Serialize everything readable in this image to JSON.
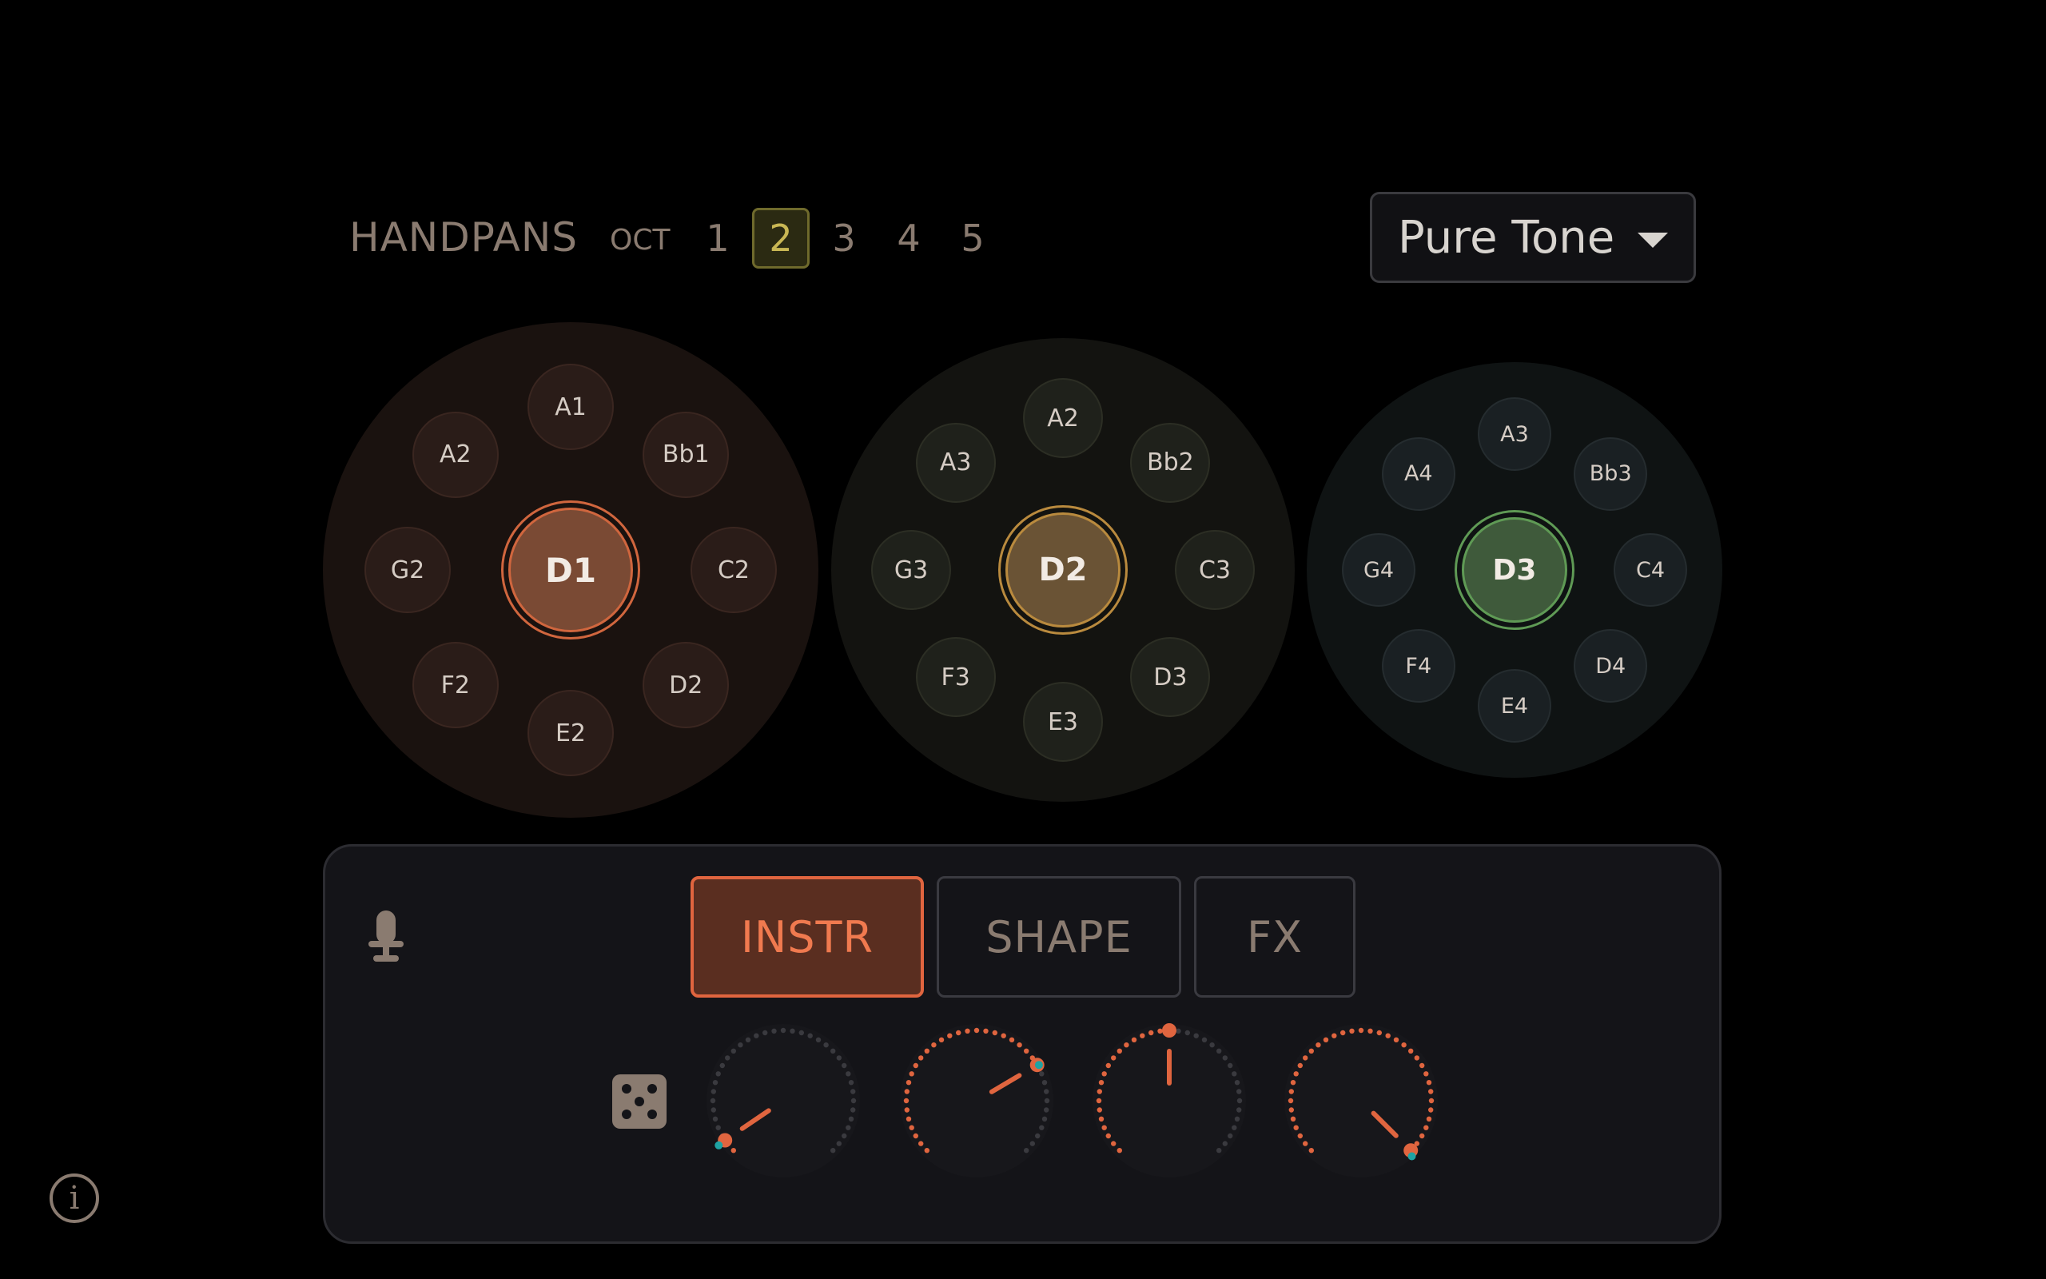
{
  "header": {
    "title": "HANDPANS",
    "oct_label": "OCT",
    "octaves": [
      "1",
      "2",
      "3",
      "4",
      "5"
    ],
    "active_octave": "2"
  },
  "sound_select": {
    "value": "Pure Tone"
  },
  "pans": [
    {
      "center": "D1",
      "notes": [
        "A1",
        "Bb1",
        "C2",
        "D2",
        "E2",
        "F2",
        "G2",
        "A2"
      ],
      "accent": "#d0663e"
    },
    {
      "center": "D2",
      "notes": [
        "A2",
        "Bb2",
        "C3",
        "D3",
        "E3",
        "F3",
        "G3",
        "A3"
      ],
      "accent": "#b98a3e"
    },
    {
      "center": "D3",
      "notes": [
        "A3",
        "Bb3",
        "C4",
        "D4",
        "E4",
        "F4",
        "G4",
        "A4"
      ],
      "accent": "#5f9a55"
    }
  ],
  "tabs": [
    "INSTR",
    "SHAPE",
    "FX"
  ],
  "active_tab": "INSTR",
  "knobs": [
    {
      "value": 0.04
    },
    {
      "value": 0.72
    },
    {
      "value": 0.5
    },
    {
      "value": 1.0
    }
  ],
  "info_symbol": "i",
  "colors": {
    "accent": "#e0653f",
    "marker": "#1fa3a3",
    "octave_active": "#c9b754"
  }
}
